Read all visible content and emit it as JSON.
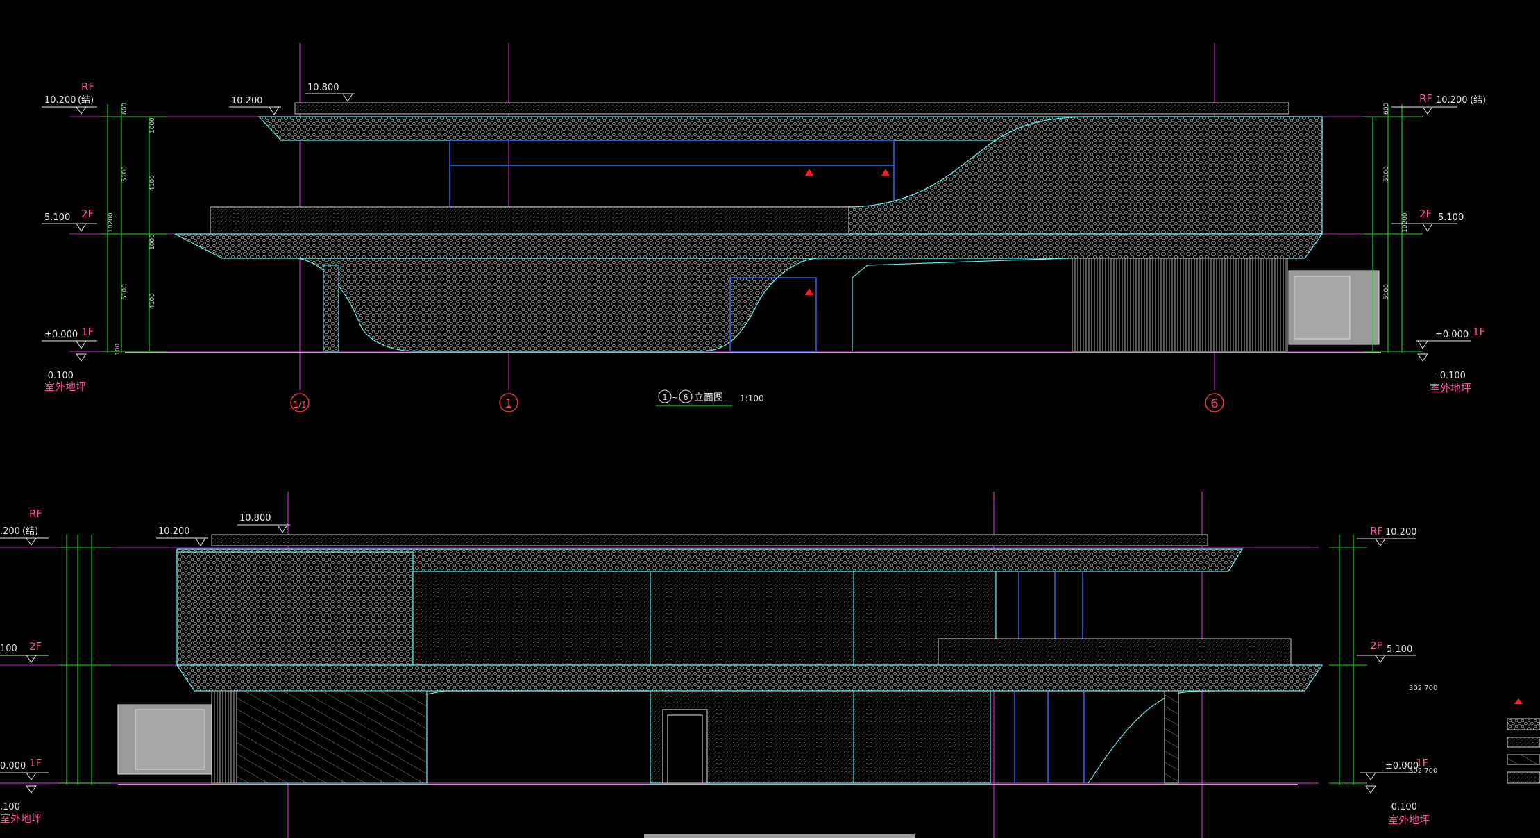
{
  "elevation_1": {
    "title_grid_a": "1",
    "title_grid_b": "6",
    "title_text": "立面图",
    "title_prefix_sep": "~",
    "scale": "1:100",
    "grid_labels": [
      "1/1",
      "1",
      "6"
    ],
    "levels_left": [
      {
        "floor": "RF",
        "elev": "10.200",
        "note": "(结)"
      },
      {
        "floor": "2F",
        "elev": "5.100"
      },
      {
        "floor": "1F",
        "elev": "±0.000"
      },
      {
        "floor": "",
        "elev": "-0.100",
        "note": "室外地坪"
      }
    ],
    "levels_right": [
      {
        "floor": "RF",
        "elev": "10.200",
        "note": "(结)"
      },
      {
        "floor": "2F",
        "elev": "5.100"
      },
      {
        "floor": "1F",
        "elev": "±0.000"
      },
      {
        "floor": "",
        "elev": "-0.100",
        "note": "室外地坪"
      }
    ],
    "top_marks": [
      {
        "elev": "10.800"
      },
      {
        "elev": "10.200"
      }
    ],
    "dims": {
      "overall": "10200",
      "floor_2": "5100",
      "floor_1": "5100",
      "parapet": "600",
      "ceiling": "1000",
      "glazing": "4100",
      "base": "100"
    }
  },
  "elevation_2": {
    "levels_left": [
      {
        "floor": "RF",
        "elev": ".200",
        "note": "(结)"
      },
      {
        "floor": "2F",
        "elev": "100"
      },
      {
        "floor": "1F",
        "elev": "0.000"
      },
      {
        "floor": "",
        "elev": ".100",
        "note": "室外地坪"
      }
    ],
    "levels_right": [
      {
        "floor": "RF",
        "elev": "10.200"
      },
      {
        "floor": "2F",
        "elev": "5.100"
      },
      {
        "floor": "1F",
        "elev": "±0.000"
      },
      {
        "floor": "",
        "elev": "-0.100",
        "note": "室外地坪"
      }
    ],
    "top_marks": [
      {
        "elev": "10.800"
      },
      {
        "elev": "10.200"
      }
    ],
    "tags": [
      "302 700",
      "302 700"
    ]
  },
  "legend": {
    "marker_color": "#ff1a1a",
    "items": [
      "triangle-marker",
      "hex-mesh-panel",
      "perforated-panel",
      "diagonal-hatch-panel",
      "dot-panel"
    ]
  },
  "colors": {
    "background": "#000000",
    "cyan": "#5ff2f0",
    "blue": "#2f6bff",
    "magenta": "#d01fd0",
    "green": "#12e01a",
    "red": "#ff2a2a",
    "pink": "#ff4fa0",
    "white": "#e8e8e8",
    "panel_gray": "#9a9a9a"
  }
}
